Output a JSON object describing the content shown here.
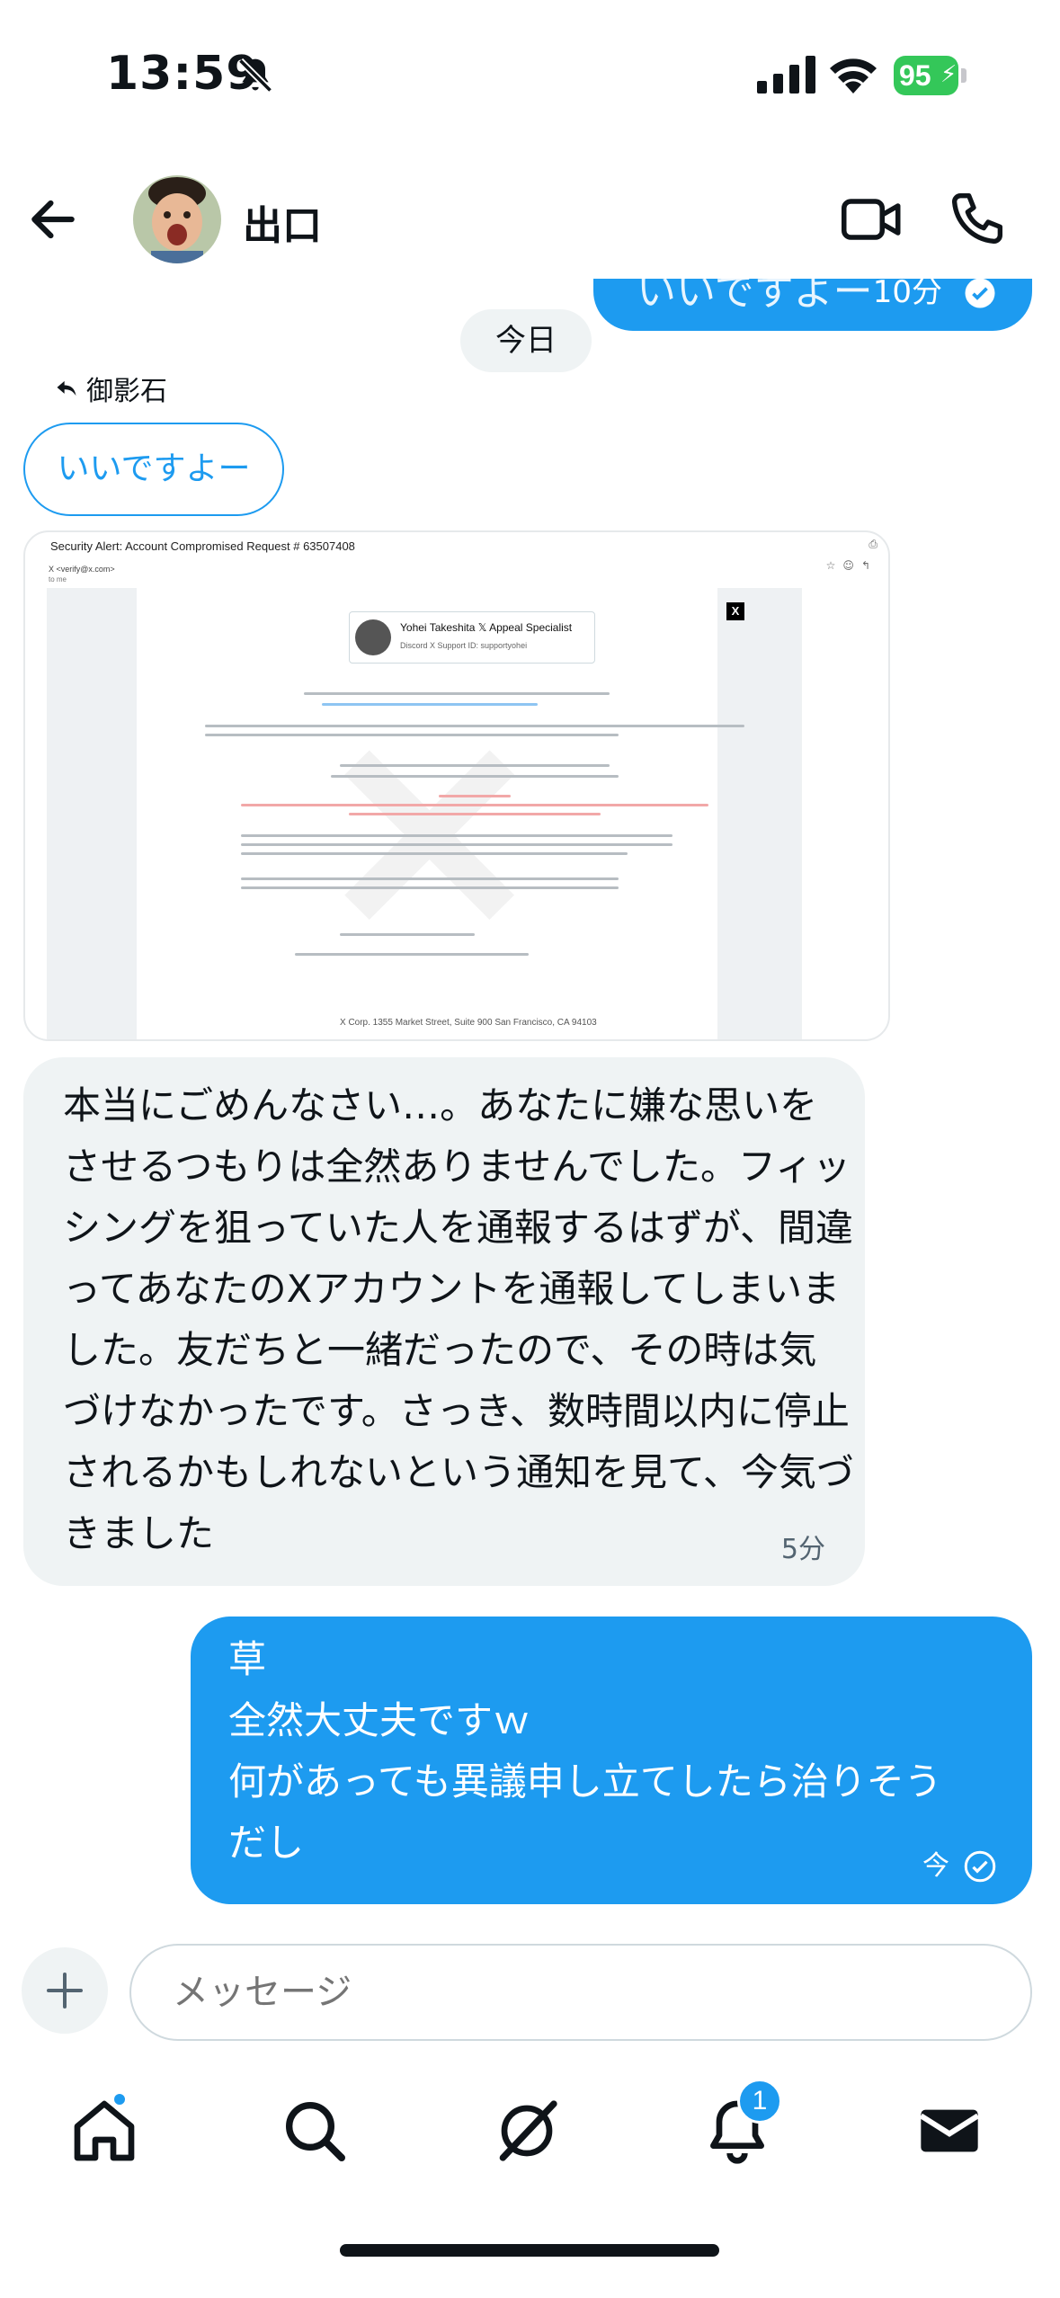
{
  "status": {
    "time": "13:59",
    "battery": "95"
  },
  "header": {
    "name": "出口"
  },
  "previous_message": {
    "text": "いいですよー",
    "time": "10分"
  },
  "date_divider": "今日",
  "reply": {
    "to": "御影石",
    "quoted": "いいですよー"
  },
  "attachment": {
    "title": "Security Alert: Account Compromised Request # 63507408",
    "from": "X <verify@x.com>",
    "to": "to me",
    "badge_name": "Yohei Takeshita 𝕏 Appeal Specialist",
    "badge_id": "Discord X Support ID: supportyohei",
    "footer": "X Corp. 1355 Market Street, Suite 900 San Francisco, CA 94103"
  },
  "incoming_message": {
    "text": "本当にごめんなさい…。あなたに嫌な思いをさせるつもりは全然ありませんでした。フィッシングを狙っていた人を通報するはずが、間違ってあなたのXアカウントを通報してしまいました。友だちと一緒だったので、その時は気づけなかったです。さっき、数時間以内に停止されるかもしれないという通知を見て、今気づきました",
    "time": "5分"
  },
  "outgoing_message": {
    "lines": [
      "草",
      "全然大丈夫ですｗ",
      "何があっても異議申し立てしたら治りそう",
      "だし"
    ],
    "time": "今"
  },
  "composer": {
    "placeholder": "メッセージ"
  },
  "tabs": {
    "notifications_count": "1"
  },
  "colors": {
    "accent": "#1d9bf0",
    "incoming_bg": "#eff3f4",
    "battery": "#34c759"
  }
}
